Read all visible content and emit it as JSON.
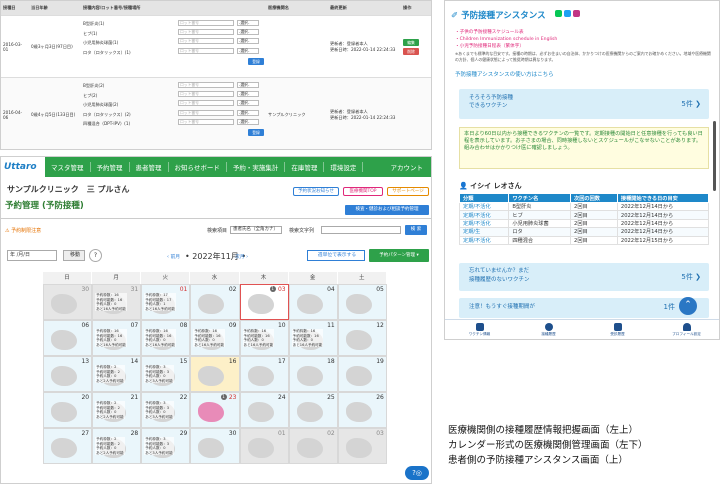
{
  "history": {
    "headers": [
      "接種日",
      "当日年齢",
      "接種内容/ロット番号/接種場所",
      "",
      "医療機関名",
      "最終更新",
      "操作"
    ],
    "rows": [
      {
        "date": "2016-03-01",
        "age": "0歳3ヶ月3日(97日目)",
        "vaccines": [
          "B型肝炎(1)",
          "ヒブ(1)",
          "小児用肺炎球菌(1)",
          "ロタ（ロタリックス）(1)"
        ],
        "updated": [
          "更新者：登録者本人",
          "更新日時：2022-01-14 22:24:33"
        ],
        "actions": [
          "編集",
          "削除"
        ]
      },
      {
        "date": "2016-04-06",
        "age": "0歳4ヶ月5日(133日目)",
        "vaccines": [
          "B型肝炎(2)",
          "ヒブ(2)",
          "小児用肺炎球菌(2)",
          "ロタ（ロタリックス）(2)",
          "四種混合（DPT-IPV）(1)"
        ],
        "clinic": "サンプルクリニック",
        "updated": [
          "更新者：登録者本人",
          "更新日時：2022-01-14 22:24:33"
        ]
      }
    ],
    "lot_placeholder": "ロット番号",
    "select_label": "-選択-",
    "register_label": "登録"
  },
  "calendar": {
    "logo": "Uttaro",
    "menu": [
      "マスタ管理",
      "予約管理",
      "患者管理",
      "お知らせボード",
      "予約・実施集計",
      "在庫管理",
      "環境設定"
    ],
    "account": "アカウント",
    "clinic_name": "サンプルクリニック　三 プルさん",
    "top_buttons": [
      "予約状況お知らせ",
      "医療機関TOP",
      "サポートページ"
    ],
    "page_title": "予約管理 (予防接種)",
    "search_button": "検査・健診および相談予約管理",
    "warning": "予約制限注意",
    "search_item_label": "検索項目",
    "search_item_value": "患者氏名（全角カナ）",
    "search_text_label": "検索文字列",
    "search_submit": "検 索",
    "date_placeholder": "年 /月/日",
    "move_label": "移動",
    "help_q": "?",
    "week_button": "週単位で表示する",
    "pattern_button": "予約パターン管理",
    "prev_month": "前月",
    "next_month": "次月",
    "month_title": "2022年11月",
    "weekdays": [
      "日",
      "月",
      "火",
      "水",
      "木",
      "金",
      "土"
    ],
    "weeks": [
      [
        {
          "d": "30",
          "other": true
        },
        {
          "d": "31",
          "other": true,
          "info": [
            "予約枠数：16",
            "予約可能数：16",
            "予約人数：0",
            "あと16人予約可能"
          ]
        },
        {
          "d": "01",
          "red": true,
          "info": [
            "予約枠数：17",
            "予約可能数：17",
            "予約人数：1",
            "あと16人予約可能"
          ]
        },
        {
          "d": "02"
        },
        {
          "d": "03",
          "red": true,
          "sel": true,
          "badge": "1"
        },
        {
          "d": "04"
        },
        {
          "d": "05"
        }
      ],
      [
        {
          "d": "06"
        },
        {
          "d": "07",
          "info": [
            "予約枠数：16",
            "予約可能数：16",
            "予約人数：0",
            "あと16人予約可能"
          ]
        },
        {
          "d": "08",
          "info": [
            "予約枠数：16",
            "予約可能数：16",
            "予約人数：0",
            "あと16人予約可能"
          ]
        },
        {
          "d": "09",
          "info": [
            "予約枠数：16",
            "予約可能数：16",
            "予約人数：0",
            "あと16人予約可能"
          ]
        },
        {
          "d": "10",
          "info": [
            "予約枠数：16",
            "予約可能数：16",
            "予約人数：0",
            "あと16人予約可能"
          ]
        },
        {
          "d": "11",
          "info": [
            "予約枠数：16",
            "予約可能数：16",
            "予約人数：0",
            "あと16人予約可能"
          ]
        },
        {
          "d": "12"
        }
      ],
      [
        {
          "d": "13"
        },
        {
          "d": "14",
          "info": [
            "予約枠数：2",
            "予約可能数：2",
            "予約人数：0",
            "あと2人予約可能"
          ]
        },
        {
          "d": "15",
          "info": [
            "予約枠数：3",
            "予約可能数：3",
            "予約人数：0",
            "あと3人予約可能"
          ]
        },
        {
          "d": "16",
          "today": true
        },
        {
          "d": "17"
        },
        {
          "d": "18"
        },
        {
          "d": "19"
        }
      ],
      [
        {
          "d": "20"
        },
        {
          "d": "21",
          "info": [
            "予約枠数：2",
            "予約可能数：2",
            "予約人数：0",
            "あと2人予約可能"
          ]
        },
        {
          "d": "22",
          "info": [
            "予約枠数：3",
            "予約可能数：3",
            "予約人数：0",
            "あと3人予約可能"
          ]
        },
        {
          "d": "23",
          "red": true,
          "pink": true,
          "badge": "1"
        },
        {
          "d": "24"
        },
        {
          "d": "25"
        },
        {
          "d": "26"
        }
      ],
      [
        {
          "d": "27"
        },
        {
          "d": "28",
          "info": [
            "予約枠数：2",
            "予約可能数：2",
            "予約人数：0",
            "あと2人予約可能"
          ]
        },
        {
          "d": "29",
          "info": [
            "予約枠数：3",
            "予約可能数：3",
            "予約人数：0",
            "あと3人予約可能"
          ]
        },
        {
          "d": "30"
        },
        {
          "d": "01",
          "other": true
        },
        {
          "d": "02",
          "other": true
        },
        {
          "d": "03",
          "other": true
        }
      ]
    ]
  },
  "assistant": {
    "title": "予防接種アシスタンス",
    "links": [
      "・子供の予防接種スケジュール表",
      "・Children Immunization schedule in English",
      "・小児予防接種日程表（繁体字）"
    ],
    "note": "※あくまでも標準的な目安です。接種の時期は、必ずお住まいの自治体、かかりつけの医療機関からのご案内でお確かめください。地域や医療機関の方針、個人の健康状態によって推奨時期は異なります。",
    "howto": "予防接種アシスタンスの使い方はこちら",
    "card1": {
      "title1": "そろそろ予防接種",
      "title2": "できるワクチン",
      "count": "5件"
    },
    "description": "本日より60日以内から接種できるワクチンの一覧です。定期接種の開始日と任意接種を行っても良い日程を表示しています。お子さまの場合、同時接種しないとスケジュールがこなせないことがあります。組み合わせはかかりつけ医に確認しましょう。",
    "person": "イシイ レオさん",
    "table_headers": [
      "分類",
      "ワクチン名",
      "次回の回数",
      "接種開始できる日の目安"
    ],
    "table_rows": [
      [
        "定期/不活化",
        "B型肝炎",
        "2回目",
        "2022年12月14日から"
      ],
      [
        "定期/不活化",
        "ヒブ",
        "2回目",
        "2022年12月14日から"
      ],
      [
        "定期/不活化",
        "小児用肺炎球菌",
        "2回目",
        "2022年12月14日から"
      ],
      [
        "定期/生",
        "ロタ",
        "2回目",
        "2022年12月14日から"
      ],
      [
        "定期/不活化",
        "四種混合",
        "2回目",
        "2022年12月15日から"
      ]
    ],
    "card2": {
      "title1": "忘れていませんか？まだ",
      "title2": "接種履歴のないワクチン",
      "count": "5件"
    },
    "card3": {
      "title": "注意！もうすぐ接種期間が",
      "count": "1件"
    },
    "tabs": [
      "ワクチン情報",
      "接種履歴",
      "受診履歴",
      "プロフィール設定"
    ]
  },
  "caption": [
    "医療機関側の接種履歴情報把握画面（左上）",
    "カレンダー形式の医療機関側管理画面（左下）",
    "患者側の予防接種アシスタンス画面（上）"
  ],
  "colors": {
    "nav_green": "#2ea14a",
    "accent_blue": "#1e88c9",
    "alert_red": "#d32f2f"
  }
}
